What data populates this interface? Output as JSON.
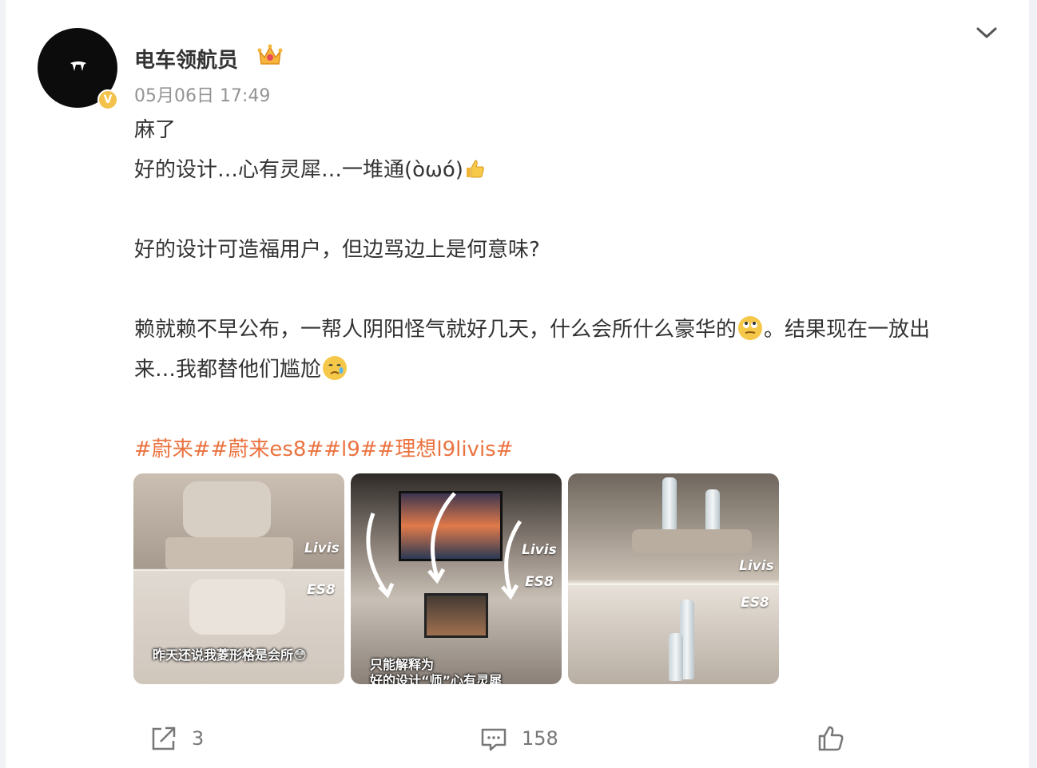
{
  "post": {
    "username": "电车领航员",
    "verified_badge": "V",
    "timestamp": "05月06日 17:49",
    "lines": [
      "麻了",
      "好的设计…心有灵犀…一堆通(òωó)",
      "好的设计可造福用户，但边骂边上是何意味?",
      "赖就赖不早公布，一帮人阴阳怪气就好几天，什么会所什么豪华的",
      "。结果现在一放出",
      "来…我都替他们尴尬"
    ],
    "hashtags": "#蔚来##蔚来es8##l9##理想l9livis#",
    "images": [
      {
        "tag_top": "Livis",
        "tag_bottom": "ES8",
        "caption": "昨天还说我菱形格是会所😳"
      },
      {
        "tag_top": "Livis",
        "tag_bottom": "ES8",
        "caption": "只能解释为",
        "caption2": "好的设计“师”心有灵犀"
      },
      {
        "tag_top": "Livis",
        "tag_bottom": "ES8"
      }
    ]
  },
  "actions": {
    "share_count": "3",
    "comment_count": "158"
  },
  "icons": [
    "more-chevron-icon",
    "crown-icon",
    "share-icon",
    "comment-icon",
    "like-icon"
  ],
  "colors": {
    "hashtag": "#eb7340",
    "badge": "#f3c24a",
    "timestamp": "#939393"
  }
}
